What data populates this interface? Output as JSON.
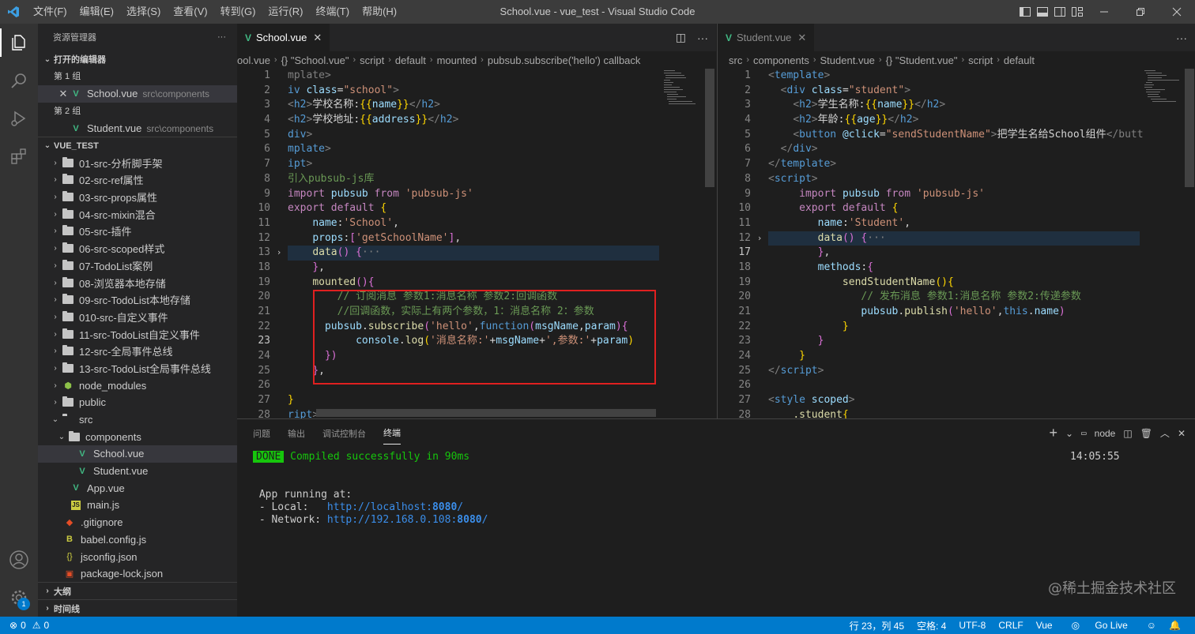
{
  "window": {
    "title": "School.vue - vue_test - Visual Studio Code"
  },
  "menu": [
    "文件(F)",
    "编辑(E)",
    "选择(S)",
    "查看(V)",
    "转到(G)",
    "运行(R)",
    "终端(T)",
    "帮助(H)"
  ],
  "sidebar": {
    "title": "资源管理器",
    "open_editors": {
      "label": "打开的编辑器",
      "group1": "第 1 组",
      "group2": "第 2 组",
      "file1": {
        "name": "School.vue",
        "path": "src\\components"
      },
      "file2": {
        "name": "Student.vue",
        "path": "src\\components"
      }
    },
    "project": "VUE_TEST",
    "folders": [
      "01-src-分析脚手架",
      "02-src-ref属性",
      "03-src-props属性",
      "04-src-mixin混合",
      "05-src-插件",
      "06-src-scoped样式",
      "07-TodoList案例",
      "08-浏览器本地存储",
      "09-src-TodoList本地存储",
      "010-src-自定义事件",
      "11-src-TodoList自定义事件",
      "12-src-全局事件总线",
      "13-src-TodoList全局事件总线"
    ],
    "node_modules": "node_modules",
    "public": "public",
    "src": "src",
    "components": "components",
    "school_vue": "School.vue",
    "student_vue": "Student.vue",
    "app_vue": "App.vue",
    "main_js": "main.js",
    "gitignore": ".gitignore",
    "babel": "babel.config.js",
    "jsconfig": "jsconfig.json",
    "package_lock": "package-lock.json",
    "outline": "大纲",
    "timeline": "时间线"
  },
  "editor_left": {
    "tab": "School.vue",
    "crumbs": [
      "ool.vue",
      "{} \"School.vue\"",
      "script",
      "default",
      "mounted",
      "pubsub.subscribe('hello') callback"
    ]
  },
  "editor_right": {
    "tab": "Student.vue",
    "crumbs": [
      "src",
      "components",
      "Student.vue",
      "{} \"Student.vue\"",
      "script",
      "default"
    ]
  },
  "panel": {
    "tabs": [
      "问题",
      "输出",
      "调试控制台",
      "终端"
    ],
    "terminal_name": "node",
    "done_badge": "DONE",
    "compiled": "Compiled successfully in 90ms",
    "time": "14:05:55",
    "running": "App running at:",
    "local_label": "- Local:   ",
    "local_url_pre": "http://localhost:",
    "local_port": "8080",
    "local_url_post": "/",
    "network_label": "- Network: ",
    "network_url_pre": "http://192.168.0.108:",
    "network_port": "8080",
    "network_url_post": "/"
  },
  "status": {
    "errors": "0",
    "warnings": "0",
    "position": "行 23，列 45",
    "spaces": "空格: 4",
    "encoding": "UTF-8",
    "eol": "CRLF",
    "lang": "Vue",
    "golive": "Go Live"
  },
  "activity_badge": "1",
  "watermark": "@稀土掘金技术社区",
  "colors": {
    "accent": "#007acc",
    "vue": "#41b883",
    "highlight_box": "#e02020"
  }
}
